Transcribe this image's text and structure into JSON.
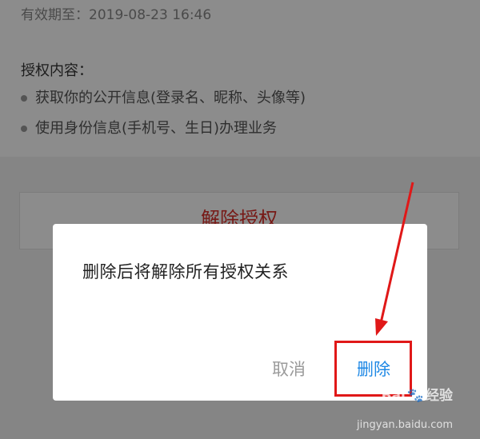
{
  "background_page": {
    "expiry": "有效期至：2019-08-23 16:46",
    "auth_title": "授权内容：",
    "auth_items": [
      "获取你的公开信息(登录名、昵称、头像等)",
      "使用身份信息(手机号、生日)办理业务"
    ],
    "revoke_label": "解除授权"
  },
  "dialog": {
    "message": "删除后将解除所有授权关系",
    "cancel_label": "取消",
    "delete_label": "删除"
  },
  "watermark": {
    "brand": "Bai",
    "brand_suffix": "经验",
    "url": "jingyan.baidu.com"
  },
  "colors": {
    "revoke": "#d9302b",
    "delete": "#1e88e5",
    "annotation": "#e01818"
  }
}
